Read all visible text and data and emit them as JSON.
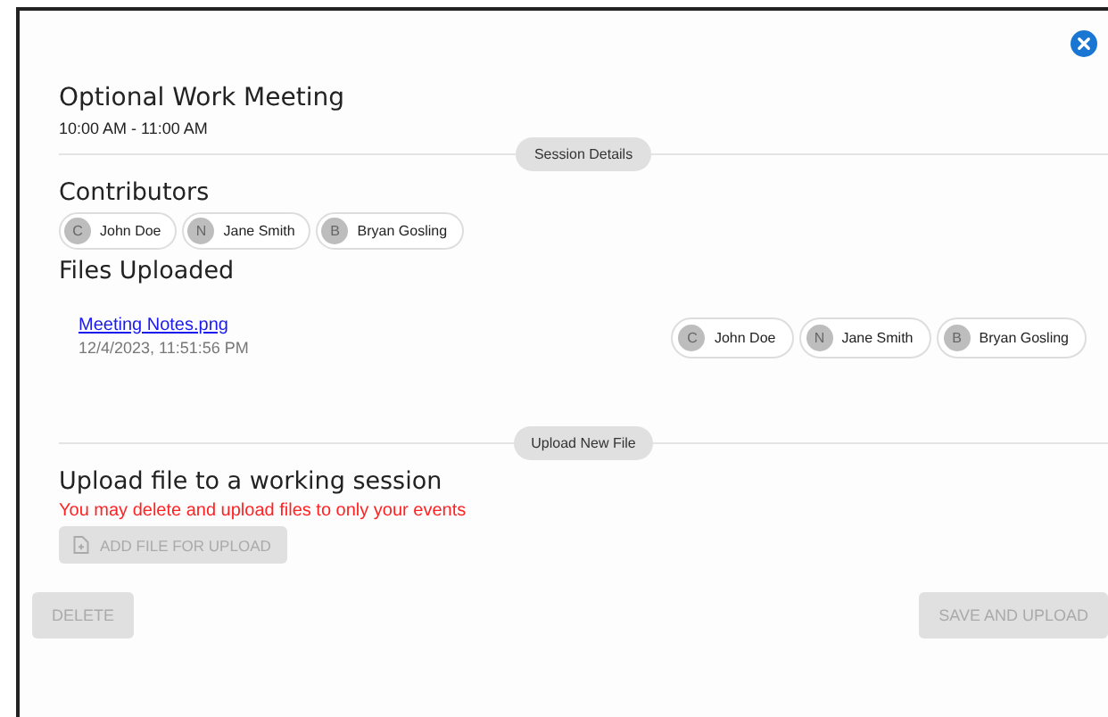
{
  "event": {
    "title": "Optional Work Meeting",
    "time": "10:00 AM - 11:00 AM"
  },
  "session_divider": "Session Details",
  "contributors": {
    "heading": "Contributors",
    "people": [
      {
        "initial": "C",
        "name": "John Doe"
      },
      {
        "initial": "N",
        "name": "Jane Smith"
      },
      {
        "initial": "B",
        "name": "Bryan Gosling"
      }
    ]
  },
  "files": {
    "heading": "Files Uploaded",
    "items": [
      {
        "name": "Meeting Notes.png",
        "date": "12/4/2023, 11:51:56 PM",
        "people": [
          {
            "initial": "C",
            "name": "John Doe"
          },
          {
            "initial": "N",
            "name": "Jane Smith"
          },
          {
            "initial": "B",
            "name": "Bryan Gosling"
          }
        ]
      }
    ]
  },
  "upload_divider": "Upload New File",
  "upload": {
    "heading": "Upload file to a working session",
    "warning": "You may delete and upload files to only your events",
    "add_button": {
      "label": "ADD FILE FOR UPLOAD",
      "disabled": true
    }
  },
  "actions": [
    {
      "label": "DELETE",
      "disabled": true
    },
    {
      "label": "SAVE AND UPLOAD",
      "disabled": true
    }
  ]
}
